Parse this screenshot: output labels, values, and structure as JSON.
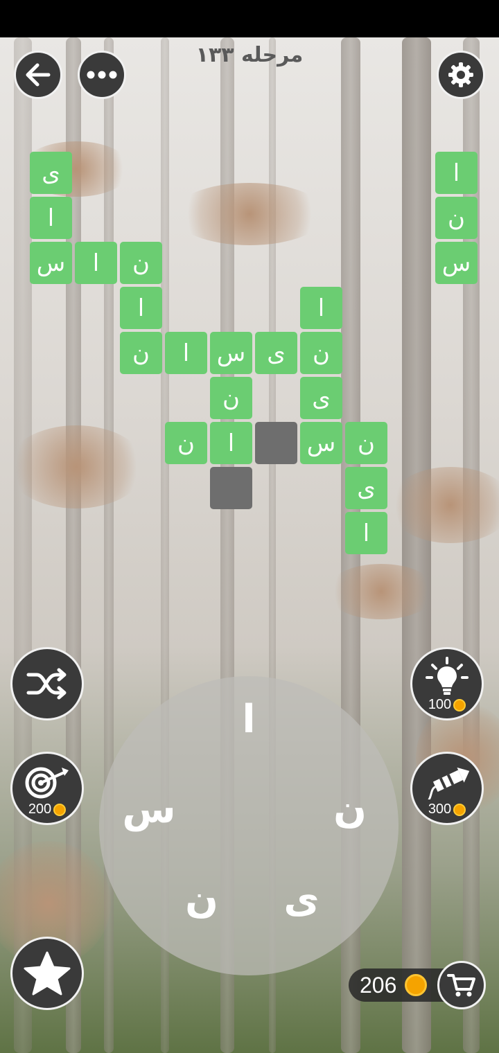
{
  "header": {
    "level_title": "مرحله ۱۳۳",
    "back_icon": "arrow-left-icon",
    "menu_icon": "more-dots-icon",
    "settings_icon": "gear-icon"
  },
  "colors": {
    "tile_filled": "#6bcd72",
    "tile_empty": "#6e6e6e",
    "button_bg": "#3a3a3a",
    "coin": "#f5a300"
  },
  "board": {
    "tiles": [
      {
        "letter": "ی"
      },
      {
        "letter": "ا"
      },
      {
        "letter": "س"
      },
      {
        "letter": "ا"
      },
      {
        "letter": "ن"
      },
      {
        "letter": "ا"
      },
      {
        "letter": "ن"
      },
      {
        "letter": "ا"
      },
      {
        "letter": "س"
      },
      {
        "letter": "ی"
      },
      {
        "letter": "ن"
      },
      {
        "letter": "ا"
      },
      {
        "letter": "ن"
      },
      {
        "letter": "ی"
      },
      {
        "letter": "ن"
      },
      {
        "letter": "ا"
      },
      {
        "letter": ""
      },
      {
        "letter": "س"
      },
      {
        "letter": "ن"
      },
      {
        "letter": ""
      },
      {
        "letter": "ی"
      },
      {
        "letter": "ا"
      },
      {
        "letter": "ا"
      },
      {
        "letter": "ن"
      },
      {
        "letter": "س"
      }
    ]
  },
  "wheel": {
    "letters": [
      "ا",
      "ن",
      "ی",
      "ن",
      "س"
    ]
  },
  "powerups": {
    "shuffle": {
      "icon": "shuffle-icon"
    },
    "hint": {
      "icon": "lightbulb-icon",
      "cost": "100"
    },
    "target": {
      "icon": "target-arrow-icon",
      "cost": "200"
    },
    "rocket": {
      "icon": "rocket-icon",
      "cost": "300"
    },
    "favorite": {
      "icon": "star-icon"
    }
  },
  "wallet": {
    "coins": "206",
    "shop_icon": "cart-icon"
  }
}
